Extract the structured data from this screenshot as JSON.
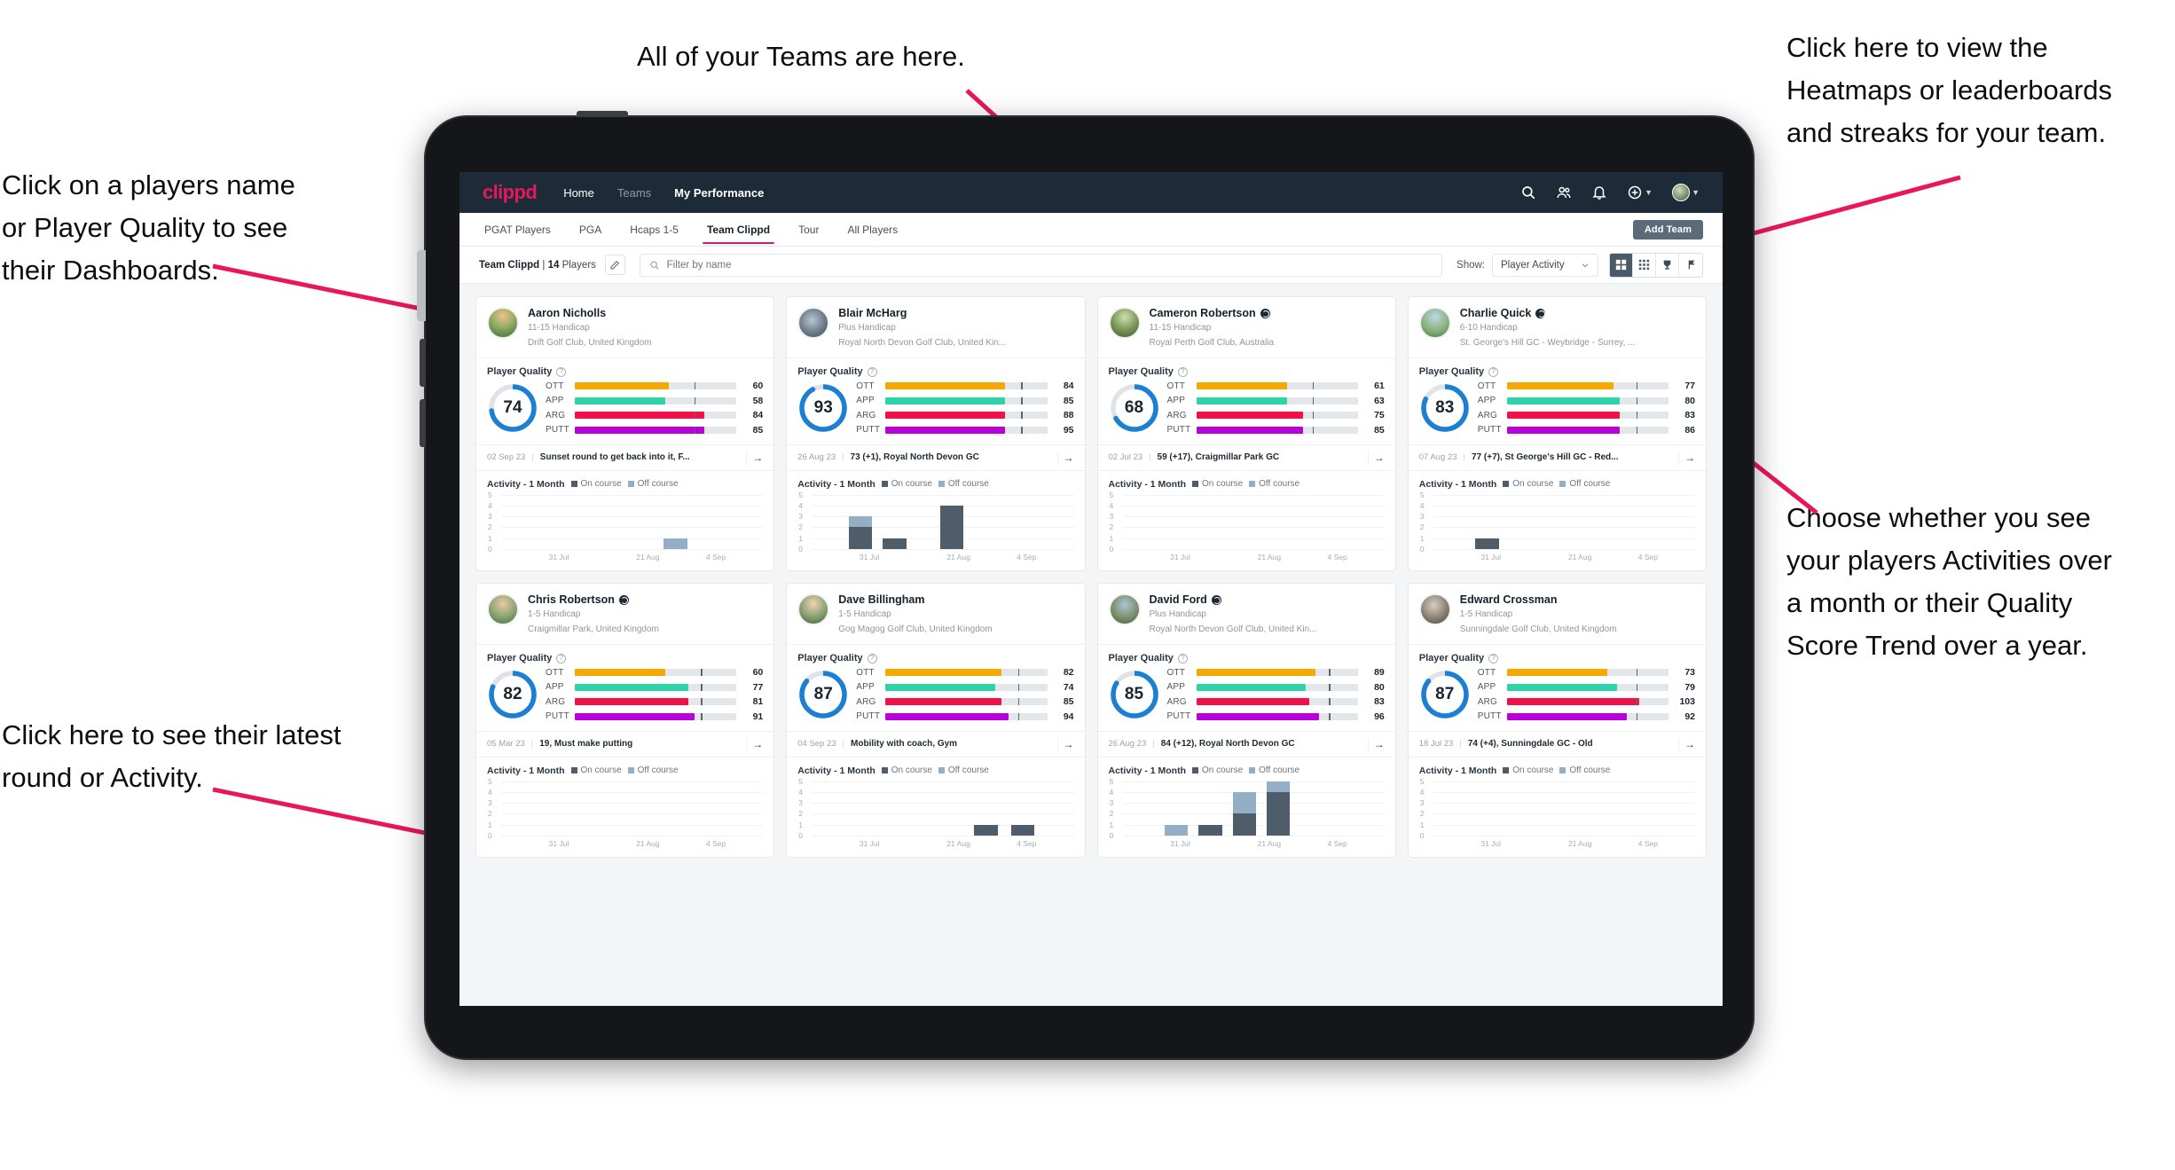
{
  "annotations": [
    {
      "id": "teams",
      "text": "All of your Teams are here."
    },
    {
      "id": "heatmaps",
      "text": "Click here to view the\nHeatmaps or leaderboards\nand streaks for your team."
    },
    {
      "id": "playername",
      "text": "Click on a players name\nor Player Quality to see\ntheir Dashboards."
    },
    {
      "id": "activity",
      "text": "Choose whether you see\nyour players Activities over\na month or their Quality\nScore Trend over a year."
    },
    {
      "id": "latestround",
      "text": "Click here to see their latest\nround or Activity."
    }
  ],
  "app": {
    "logo": "clippd",
    "nav": [
      {
        "label": "Home",
        "state": "normal"
      },
      {
        "label": "Teams",
        "state": "dim"
      },
      {
        "label": "My Performance",
        "state": "bold"
      }
    ],
    "header_icons": [
      "search-icon",
      "people-icon",
      "bell-icon",
      "plus-circle-icon",
      "avatar"
    ],
    "tabs": [
      {
        "label": "PGAT Players",
        "active": false
      },
      {
        "label": "PGA",
        "active": false
      },
      {
        "label": "Hcaps 1-5",
        "active": false
      },
      {
        "label": "Team Clippd",
        "active": true
      },
      {
        "label": "Tour",
        "active": false
      },
      {
        "label": "All Players",
        "active": false
      }
    ],
    "add_team_label": "Add Team",
    "toolbar": {
      "team_name": "Team Clippd",
      "team_separator": "|",
      "player_count": "14",
      "players_label": "Players",
      "edit_icon": "pencil-icon",
      "search_placeholder": "Filter by name",
      "search_value": "",
      "show_label": "Show:",
      "show_value": "Player Activity",
      "show_options": [
        "Player Activity",
        "Quality Score Trend"
      ],
      "view_buttons": [
        "grid-large-icon",
        "grid-small-icon",
        "trophy-icon",
        "flag-icon"
      ],
      "active_view": 0
    }
  },
  "colors": {
    "accent": "#e8175d",
    "header_bg": "#1d2b38",
    "ott": "#f5a800",
    "app": "#2ed3a7",
    "arg": "#f2104a",
    "putt": "#b800d8",
    "ring": "#1b7fd4",
    "on_course": "#4e5d69",
    "off_course": "#93aec5"
  },
  "quality_metrics": [
    "OTT",
    "APP",
    "ARG",
    "PUTT"
  ],
  "activity": {
    "title": "Activity - 1 Month",
    "legend": [
      {
        "label": "On course",
        "color": "#4e5d69"
      },
      {
        "label": "Off course",
        "color": "#93aec5"
      }
    ],
    "y_ticks": [
      5,
      4,
      3,
      2,
      1,
      0
    ],
    "x_ticks": [
      "31 Jul",
      "21 Aug",
      "4 Sep"
    ]
  },
  "player_quality_label": "Player Quality",
  "players": [
    {
      "name": "Aaron Nicholls",
      "verified": false,
      "handicap": "11-15 Handicap",
      "club": "Drift Golf Club, United Kingdom",
      "avatar_css": "radial-gradient(circle at 50% 25%, #f3c08a 0%, #8fae63 45%, #3f6b38 100%)",
      "quality_score": 74,
      "metrics": [
        {
          "label": "OTT",
          "value": 60,
          "fill": 58,
          "tick": 74
        },
        {
          "label": "APP",
          "value": 58,
          "fill": 56,
          "tick": 74
        },
        {
          "label": "ARG",
          "value": 84,
          "fill": 80,
          "tick": 74
        },
        {
          "label": "PUTT",
          "value": 85,
          "fill": 80,
          "tick": 74
        }
      ],
      "round": {
        "date": "02 Sep 23",
        "text": "Sunset round to get back into it, F..."
      },
      "chart_data": {
        "type": "bar",
        "title": "Activity - 1 Month",
        "categories": [
          "31 Jul",
          "21 Aug",
          "4 Sep"
        ],
        "ylim": [
          0,
          5
        ],
        "bars": [
          {
            "pos": 62,
            "on": 0,
            "off": 1
          }
        ]
      }
    },
    {
      "name": "Blair McHarg",
      "verified": false,
      "handicap": "Plus Handicap",
      "club": "Royal North Devon Golf Club, United Kin...",
      "avatar_css": "radial-gradient(circle at 45% 40%, #b8c6d2 0%, #6d7c88 55%, #3d4a54 100%)",
      "quality_score": 93,
      "metrics": [
        {
          "label": "OTT",
          "value": 84,
          "fill": 74,
          "tick": 84
        },
        {
          "label": "APP",
          "value": 85,
          "fill": 74,
          "tick": 84
        },
        {
          "label": "ARG",
          "value": 88,
          "fill": 74,
          "tick": 84
        },
        {
          "label": "PUTT",
          "value": 95,
          "fill": 74,
          "tick": 84
        }
      ],
      "round": {
        "date": "26 Aug 23",
        "text": "73 (+1), Royal North Devon GC"
      },
      "chart_data": {
        "type": "bar",
        "title": "Activity - 1 Month",
        "categories": [
          "31 Jul",
          "21 Aug",
          "4 Sep"
        ],
        "ylim": [
          0,
          5
        ],
        "bars": [
          {
            "pos": 14,
            "on": 2,
            "off": 1
          },
          {
            "pos": 27,
            "on": 1,
            "off": 0
          },
          {
            "pos": 49,
            "on": 4,
            "off": 0
          }
        ]
      }
    },
    {
      "name": "Cameron Robertson",
      "verified": true,
      "handicap": "11-15 Handicap",
      "club": "Royal Perth Golf Club, Australia",
      "avatar_css": "radial-gradient(circle at 50% 30%, #cfe0b0 0%, #7d9a5c 50%, #3d5a2e 100%)",
      "quality_score": 68,
      "metrics": [
        {
          "label": "OTT",
          "value": 61,
          "fill": 56,
          "tick": 72
        },
        {
          "label": "APP",
          "value": 63,
          "fill": 56,
          "tick": 72
        },
        {
          "label": "ARG",
          "value": 75,
          "fill": 66,
          "tick": 72
        },
        {
          "label": "PUTT",
          "value": 85,
          "fill": 66,
          "tick": 72
        }
      ],
      "round": {
        "date": "02 Jul 23",
        "text": "59 (+17), Craigmillar Park GC"
      },
      "chart_data": {
        "type": "bar",
        "title": "Activity - 1 Month",
        "categories": [
          "31 Jul",
          "21 Aug",
          "4 Sep"
        ],
        "ylim": [
          0,
          5
        ],
        "bars": []
      }
    },
    {
      "name": "Charlie Quick",
      "verified": true,
      "handicap": "6-10 Handicap",
      "club": "St. George's Hill GC - Weybridge - Surrey, ...",
      "avatar_css": "radial-gradient(circle at 50% 30%, #bcd7ea 0%, #8bb27a 55%, #4a7a3c 100%)",
      "quality_score": 83,
      "metrics": [
        {
          "label": "OTT",
          "value": 77,
          "fill": 66,
          "tick": 80
        },
        {
          "label": "APP",
          "value": 80,
          "fill": 70,
          "tick": 80
        },
        {
          "label": "ARG",
          "value": 83,
          "fill": 70,
          "tick": 80
        },
        {
          "label": "PUTT",
          "value": 86,
          "fill": 70,
          "tick": 80
        }
      ],
      "round": {
        "date": "07 Aug 23",
        "text": "77 (+7), St George's Hill GC - Red..."
      },
      "chart_data": {
        "type": "bar",
        "title": "Activity - 1 Month",
        "categories": [
          "31 Jul",
          "21 Aug",
          "4 Sep"
        ],
        "ylim": [
          0,
          5
        ],
        "bars": [
          {
            "pos": 16,
            "on": 1,
            "off": 0
          }
        ]
      }
    },
    {
      "name": "Chris Robertson",
      "verified": true,
      "handicap": "1-5 Handicap",
      "club": "Craigmillar Park, United Kingdom",
      "avatar_css": "radial-gradient(circle at 50% 30%, #e8c9a8 0%, #7fa06a 60%, #46663a 100%)",
      "quality_score": 82,
      "metrics": [
        {
          "label": "OTT",
          "value": 60,
          "fill": 56,
          "tick": 78
        },
        {
          "label": "APP",
          "value": 77,
          "fill": 70,
          "tick": 78
        },
        {
          "label": "ARG",
          "value": 81,
          "fill": 70,
          "tick": 78
        },
        {
          "label": "PUTT",
          "value": 91,
          "fill": 74,
          "tick": 78
        }
      ],
      "round": {
        "date": "05 Mar 23",
        "text": "19, Must make putting"
      },
      "chart_data": {
        "type": "bar",
        "title": "Activity - 1 Month",
        "categories": [
          "31 Jul",
          "21 Aug",
          "4 Sep"
        ],
        "ylim": [
          0,
          5
        ],
        "bars": []
      }
    },
    {
      "name": "Dave Billingham",
      "verified": false,
      "handicap": "1-5 Handicap",
      "club": "Gog Magog Golf Club, United Kingdom",
      "avatar_css": "radial-gradient(circle at 50% 30%, #f0d3b4 0%, #7f9a6a 60%, #3f5e35 100%)",
      "quality_score": 87,
      "metrics": [
        {
          "label": "OTT",
          "value": 82,
          "fill": 72,
          "tick": 82
        },
        {
          "label": "APP",
          "value": 74,
          "fill": 68,
          "tick": 82
        },
        {
          "label": "ARG",
          "value": 85,
          "fill": 72,
          "tick": 82
        },
        {
          "label": "PUTT",
          "value": 94,
          "fill": 76,
          "tick": 82
        }
      ],
      "round": {
        "date": "04 Sep 23",
        "text": "Mobility with coach, Gym"
      },
      "chart_data": {
        "type": "bar",
        "title": "Activity - 1 Month",
        "categories": [
          "31 Jul",
          "21 Aug",
          "4 Sep"
        ],
        "ylim": [
          0,
          5
        ],
        "bars": [
          {
            "pos": 62,
            "on": 1,
            "off": 0
          },
          {
            "pos": 76,
            "on": 1,
            "off": 0
          }
        ]
      }
    },
    {
      "name": "David Ford",
      "verified": true,
      "handicap": "Plus Handicap",
      "club": "Royal North Devon Golf Club, United Kin...",
      "avatar_css": "radial-gradient(circle at 50% 35%, #a8c6dc 0%, #7d8f6a 55%, #4b5f3a 100%)",
      "quality_score": 85,
      "metrics": [
        {
          "label": "OTT",
          "value": 89,
          "fill": 74,
          "tick": 82
        },
        {
          "label": "APP",
          "value": 80,
          "fill": 68,
          "tick": 82
        },
        {
          "label": "ARG",
          "value": 83,
          "fill": 70,
          "tick": 82
        },
        {
          "label": "PUTT",
          "value": 96,
          "fill": 76,
          "tick": 82
        }
      ],
      "round": {
        "date": "26 Aug 23",
        "text": "84 (+12), Royal North Devon GC"
      },
      "chart_data": {
        "type": "bar",
        "title": "Activity - 1 Month",
        "categories": [
          "31 Jul",
          "21 Aug",
          "4 Sep"
        ],
        "ylim": [
          0,
          5
        ],
        "bars": [
          {
            "pos": 16,
            "on": 0,
            "off": 1
          },
          {
            "pos": 29,
            "on": 1,
            "off": 0
          },
          {
            "pos": 42,
            "on": 2,
            "off": 2
          },
          {
            "pos": 55,
            "on": 4,
            "off": 1
          }
        ]
      }
    },
    {
      "name": "Edward Crossman",
      "verified": false,
      "handicap": "1-5 Handicap",
      "club": "Sunningdale Golf Club, United Kingdom",
      "avatar_css": "radial-gradient(circle at 45% 35%, #d8cfc4 0%, #8a7f72 55%, #4a423a 100%)",
      "quality_score": 87,
      "metrics": [
        {
          "label": "OTT",
          "value": 73,
          "fill": 62,
          "tick": 80
        },
        {
          "label": "APP",
          "value": 79,
          "fill": 68,
          "tick": 80
        },
        {
          "label": "ARG",
          "value": 103,
          "fill": 82,
          "tick": 80
        },
        {
          "label": "PUTT",
          "value": 92,
          "fill": 74,
          "tick": 80
        }
      ],
      "round": {
        "date": "18 Jul 23",
        "text": "74 (+4), Sunningdale GC - Old"
      },
      "chart_data": {
        "type": "bar",
        "title": "Activity - 1 Month",
        "categories": [
          "31 Jul",
          "21 Aug",
          "4 Sep"
        ],
        "ylim": [
          0,
          5
        ],
        "bars": []
      }
    }
  ]
}
